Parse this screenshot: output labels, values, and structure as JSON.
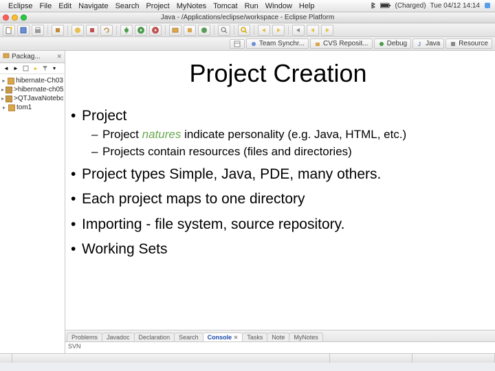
{
  "mac_menu": {
    "items": [
      "Eclipse",
      "File",
      "Edit",
      "Navigate",
      "Search",
      "Project",
      "MyNotes",
      "Tomcat",
      "Run",
      "Window",
      "Help"
    ],
    "status_time": "Tue 04/12 14:14",
    "charge": "(Charged)"
  },
  "titlebar": {
    "title": "Java - /Applications/eclipse/workspace - Eclipse Platform"
  },
  "perspectives": {
    "items": [
      {
        "label": "Team Synchr..."
      },
      {
        "label": "CVS Reposit..."
      },
      {
        "label": "Debug"
      },
      {
        "label": "Java"
      },
      {
        "label": "Resource"
      }
    ]
  },
  "package_explorer": {
    "title": "Packag...",
    "items": [
      {
        "label": "hibernate-Ch03",
        "deco": "",
        "expander": "▸"
      },
      {
        "label": ">hibernate-ch05",
        "deco": "warn",
        "expander": "▸"
      },
      {
        "label": ">QTJavaNotebook",
        "deco": "warn",
        "expander": "▸"
      },
      {
        "label": "tom1",
        "deco": "",
        "expander": "▸"
      }
    ]
  },
  "slide": {
    "title": "Project Creation",
    "b1": "Project",
    "b1s1_pre": "Project ",
    "b1s1_em": "natures",
    "b1s1_post": " indicate personality (e.g. Java, HTML, etc.)",
    "b1s2": "Projects contain resources (files and directories)",
    "b2": "Project types  Simple, Java, PDE, many others.",
    "b3": "Each project maps to one directory",
    "b4": "Importing - file system, source repository.",
    "b5": "Working Sets"
  },
  "bottom_tabs": {
    "items": [
      "Problems",
      "Javadoc",
      "Declaration",
      "Search",
      "Console",
      "Tasks",
      "Note",
      "MyNotes"
    ],
    "active_index": 4,
    "svn_label": "SVN"
  }
}
